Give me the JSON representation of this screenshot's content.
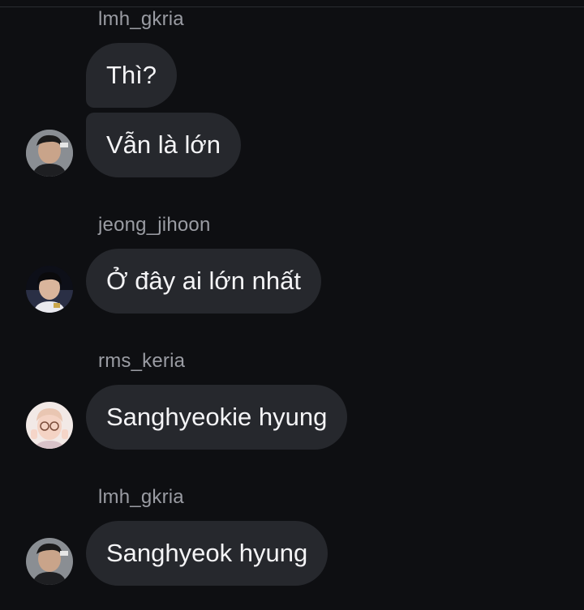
{
  "messages": [
    {
      "sender": "lmh_gkria",
      "avatar_icon": "profile-photo-icon",
      "bubbles": [
        "Thì?",
        "Vẫn là lớn"
      ]
    },
    {
      "sender": "jeong_jihoon",
      "avatar_icon": "profile-photo-icon",
      "bubbles": [
        "Ở đây ai lớn nhất"
      ]
    },
    {
      "sender": "rms_keria",
      "avatar_icon": "profile-photo-icon",
      "bubbles": [
        "Sanghyeokie hyung"
      ]
    },
    {
      "sender": "lmh_gkria",
      "avatar_icon": "profile-photo-icon",
      "bubbles": [
        "Sanghyeok hyung"
      ]
    }
  ],
  "colors": {
    "background": "#0e0f12",
    "bubble": "#26282d",
    "username": "#9a9ca3",
    "message_text": "#f4f4f6"
  }
}
